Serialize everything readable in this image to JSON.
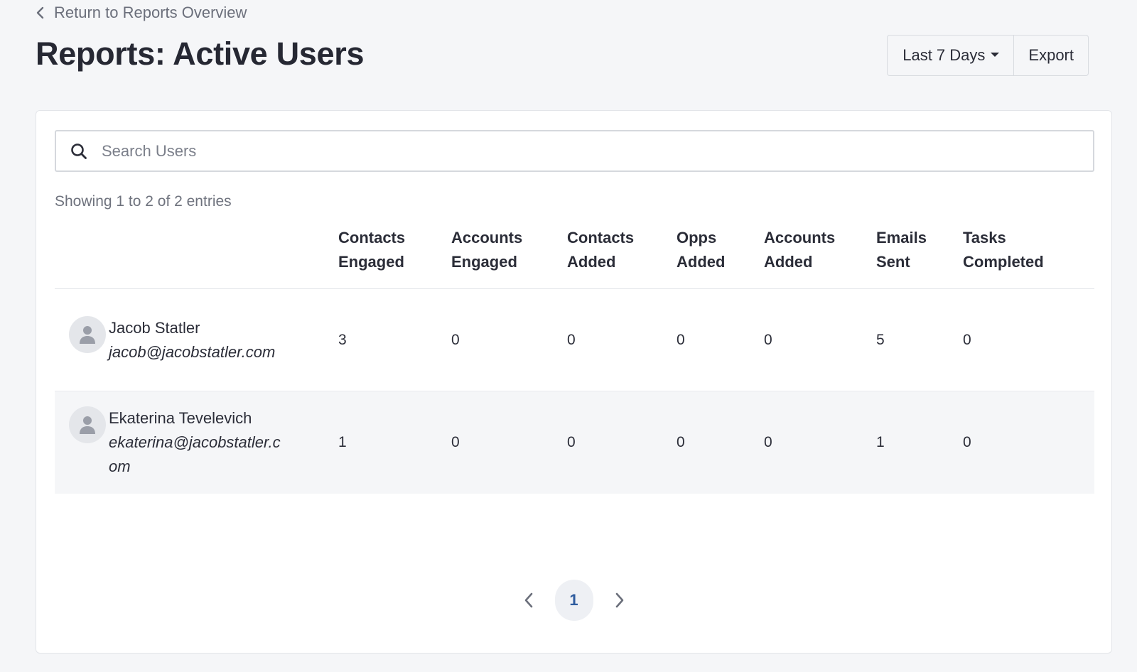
{
  "nav": {
    "back_label": "Return to Reports Overview"
  },
  "header": {
    "title": "Reports: Active Users",
    "date_range": "Last 7 Days",
    "export_label": "Export"
  },
  "search": {
    "placeholder": "Search Users",
    "value": ""
  },
  "summary": "Showing 1 to 2 of 2 entries",
  "table": {
    "columns": [
      [
        "Contacts",
        "Engaged"
      ],
      [
        "Accounts",
        "Engaged"
      ],
      [
        "Contacts",
        "Added"
      ],
      [
        "Opps",
        "Added"
      ],
      [
        "Accounts",
        "Added"
      ],
      [
        "Emails",
        "Sent"
      ],
      [
        "Tasks",
        "Completed"
      ]
    ],
    "rows": [
      {
        "name": "Jacob Statler",
        "email": "jacob@jacobstatler.com",
        "values": [
          "3",
          "0",
          "0",
          "0",
          "0",
          "5",
          "0"
        ]
      },
      {
        "name": "Ekaterina Tevelevich",
        "email": "ekaterina@jacobstatler.com",
        "values": [
          "1",
          "0",
          "0",
          "0",
          "0",
          "1",
          "0"
        ]
      }
    ]
  },
  "pagination": {
    "current_page": "1"
  },
  "icons": {
    "back": "chevron-left-icon",
    "search": "search-icon",
    "avatar": "user-avatar-icon",
    "prev": "chevron-left-icon",
    "next": "chevron-right-icon"
  },
  "colors": {
    "accent": "#2e5c9e",
    "background": "#f5f6f8"
  }
}
